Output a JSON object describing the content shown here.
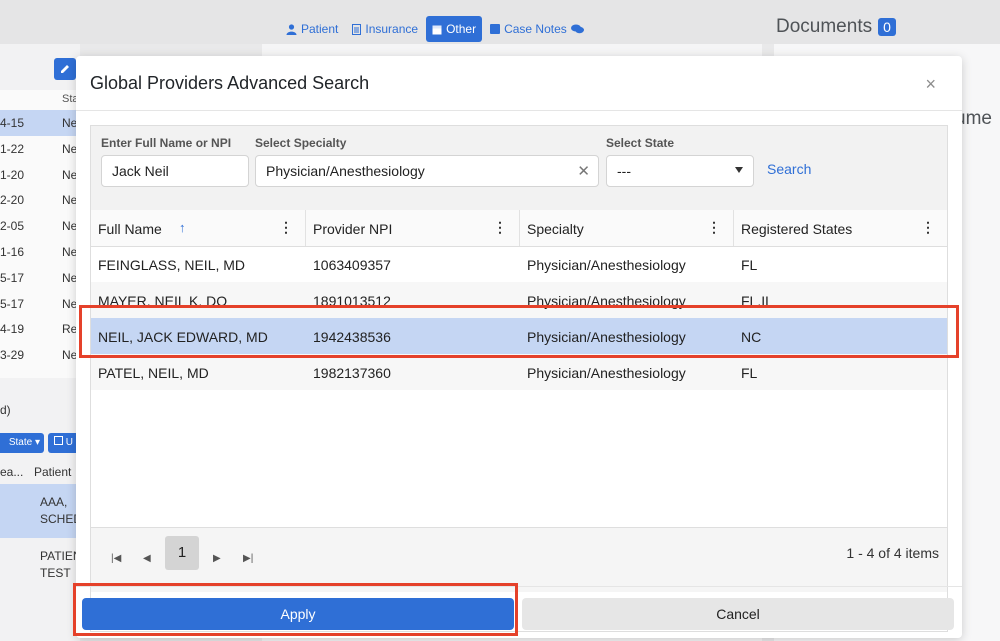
{
  "background": {
    "tabs": [
      {
        "label": "Patient",
        "icon": "user-icon",
        "active": false
      },
      {
        "label": "Insurance",
        "icon": "document-icon",
        "active": false
      },
      {
        "label": "Other",
        "icon": "calendar-icon",
        "active": true
      },
      {
        "label": "Case Notes",
        "icon": "note-icon",
        "active": false
      }
    ],
    "documents_title": "Documents",
    "documents_count": "0",
    "right_partial_text": "ume",
    "left_column_header": "Sta",
    "left_rows": [
      {
        "date": "4-15",
        "status": "Ne",
        "selected": true
      },
      {
        "date": "1-22",
        "status": "Ne"
      },
      {
        "date": "1-20",
        "status": "Ne"
      },
      {
        "date": "2-20",
        "status": "Ne"
      },
      {
        "date": "2-05",
        "status": "Ne"
      },
      {
        "date": "1-16",
        "status": "Ne"
      },
      {
        "date": "5-17",
        "status": "Ne"
      },
      {
        "date": "5-17",
        "status": "Ne"
      },
      {
        "date": "4-19",
        "status": "Re"
      },
      {
        "date": "3-29",
        "status": "Ne"
      }
    ],
    "left_lower_text": "d)",
    "state_button": "State ▾",
    "u_button": "U",
    "lower_headers": {
      "col1": "ea...",
      "col2": "Patient"
    },
    "patients": [
      {
        "line1": "AAA,",
        "line2": "SCHED"
      },
      {
        "line1": "PATIEN",
        "line2": "TEST"
      }
    ]
  },
  "modal": {
    "title": "Global Providers Advanced Search",
    "close_glyph": "×",
    "filters": {
      "name_label": "Enter Full Name or NPI",
      "name_value": "Jack Neil",
      "specialty_label": "Select Specialty",
      "specialty_value": "Physician/Anesthesiology",
      "state_label": "Select State",
      "state_value": "---",
      "search_label": "Search"
    },
    "columns": [
      "Full Name",
      "Provider NPI",
      "Specialty",
      "Registered States"
    ],
    "rows": [
      {
        "name": "FEINGLASS, NEIL, MD",
        "npi": "1063409357",
        "specialty": "Physician/Anesthesiology",
        "states": "FL"
      },
      {
        "name": "MAYER, NEIL K, DO",
        "npi": "1891013512",
        "specialty": "Physician/Anesthesiology",
        "states": "FL,IL"
      },
      {
        "name": "NEIL, JACK EDWARD, MD",
        "npi": "1942438536",
        "specialty": "Physician/Anesthesiology",
        "states": "NC",
        "selected": true
      },
      {
        "name": "PATEL, NEIL, MD",
        "npi": "1982137360",
        "specialty": "Physician/Anesthesiology",
        "states": "FL"
      }
    ],
    "pager": {
      "current_page": "1",
      "info": "1 - 4 of 4 items"
    },
    "apply_label": "Apply",
    "cancel_label": "Cancel"
  },
  "colors": {
    "primary": "#2f6fd6",
    "selected_row": "#c5d6f3",
    "highlight_box": "#e5412a"
  }
}
